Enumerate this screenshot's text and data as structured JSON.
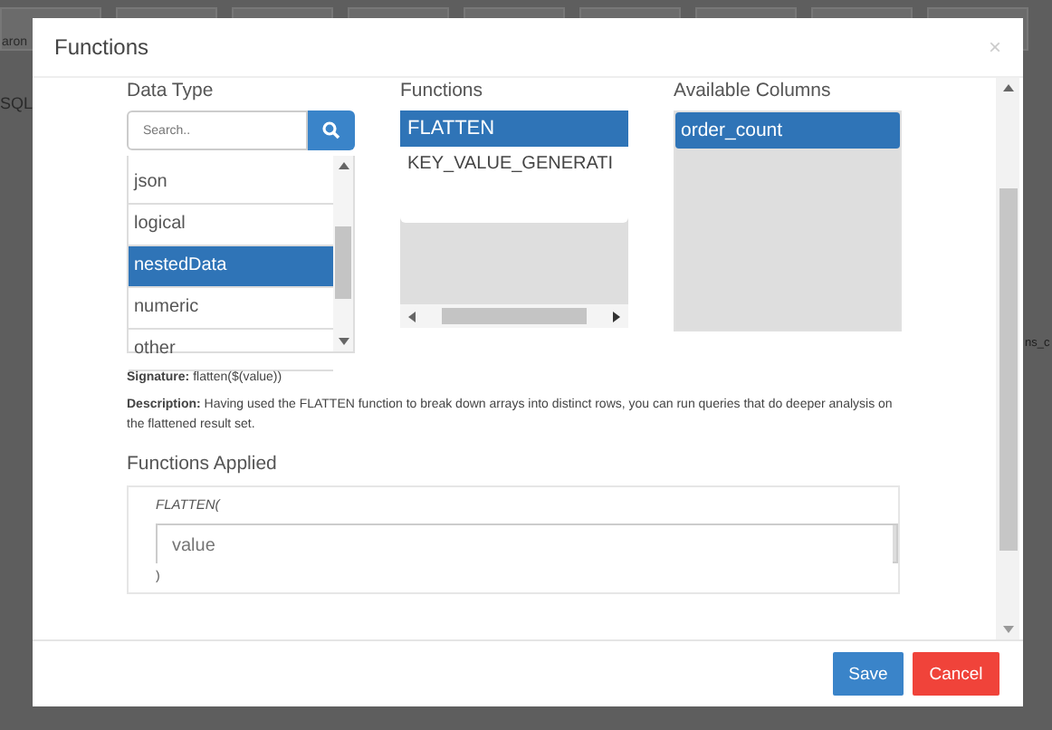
{
  "background": {
    "texts": [
      "aron",
      "SQL",
      "ns_c"
    ]
  },
  "window": {
    "title": "Functions",
    "close": "×"
  },
  "data_type": {
    "label": "Data Type",
    "search": {
      "placeholder": "Search.."
    },
    "items": [
      {
        "label": "json",
        "selected": false
      },
      {
        "label": "logical",
        "selected": false
      },
      {
        "label": "nestedData",
        "selected": true
      },
      {
        "label": "numeric",
        "selected": false
      },
      {
        "label": "other",
        "selected": false
      }
    ]
  },
  "functions": {
    "label": "Functions",
    "items": [
      {
        "label": "FLATTEN",
        "selected": true
      },
      {
        "label": "KEY_VALUE_GENERATI",
        "selected": false
      }
    ]
  },
  "available_columns": {
    "label": "Available Columns",
    "items": [
      {
        "label": "order_count",
        "selected": true
      }
    ]
  },
  "signature": {
    "label": "Signature:",
    "text": "flatten($(value))"
  },
  "description": {
    "label": "Description:",
    "text": "Having used the FLATTEN function to break down arrays into distinct rows, you can run queries that do deeper analysis on the flattened result set."
  },
  "functions_applied": {
    "heading": "Functions Applied",
    "call": "FLATTEN(",
    "argument": {
      "placeholder": "value"
    },
    "close": ")"
  },
  "buttons": [
    {
      "label": "Save",
      "kind": "primary"
    },
    {
      "label": "Cancel",
      "kind": "danger"
    }
  ]
}
